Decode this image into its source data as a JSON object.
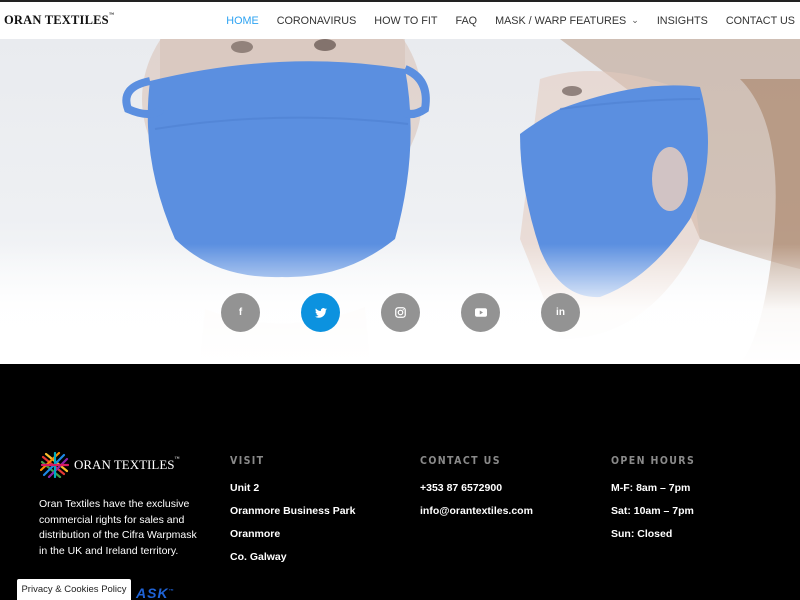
{
  "header": {
    "logo": "ORAN TEXTILES",
    "nav": [
      {
        "label": "HOME",
        "active": true
      },
      {
        "label": "CORONAVIRUS"
      },
      {
        "label": "HOW TO FIT"
      },
      {
        "label": "FAQ"
      },
      {
        "label": "MASK / WARP FEATURES",
        "has_dropdown": true
      },
      {
        "label": "INSIGHTS"
      },
      {
        "label": "CONTACT US"
      }
    ]
  },
  "hero": {
    "mask_color": "#5b8fe0",
    "social": [
      {
        "icon": "facebook-icon",
        "glyph": "f"
      },
      {
        "icon": "twitter-icon",
        "glyph": "🐦",
        "color": "#0c92df"
      },
      {
        "icon": "instagram-icon",
        "glyph": "◎"
      },
      {
        "icon": "youtube-icon",
        "glyph": "▶"
      },
      {
        "icon": "linkedin-icon",
        "glyph": "in"
      }
    ]
  },
  "footer": {
    "logo": "ORAN TEXTILES",
    "about": "Oran Textiles have the exclusive commercial rights for sales and distribution of the Cifra Warpmask in the UK and Ireland territory.",
    "visit": {
      "title": "VISIT",
      "lines": [
        "Unit 2",
        "Oranmore Business Park",
        "Oranmore",
        "Co. Galway"
      ]
    },
    "contact": {
      "title": "CONTACT US",
      "lines": [
        "+353 87 6572900",
        "info@orantextiles.com"
      ]
    },
    "hours": {
      "title": "OPEN HOURS",
      "lines": [
        "M-F: 8am – 7pm",
        "Sat: 10am – 7pm",
        "Sun: Closed"
      ]
    },
    "privacy": "Privacy & Cookies Policy",
    "partner_logo": "ASK"
  }
}
